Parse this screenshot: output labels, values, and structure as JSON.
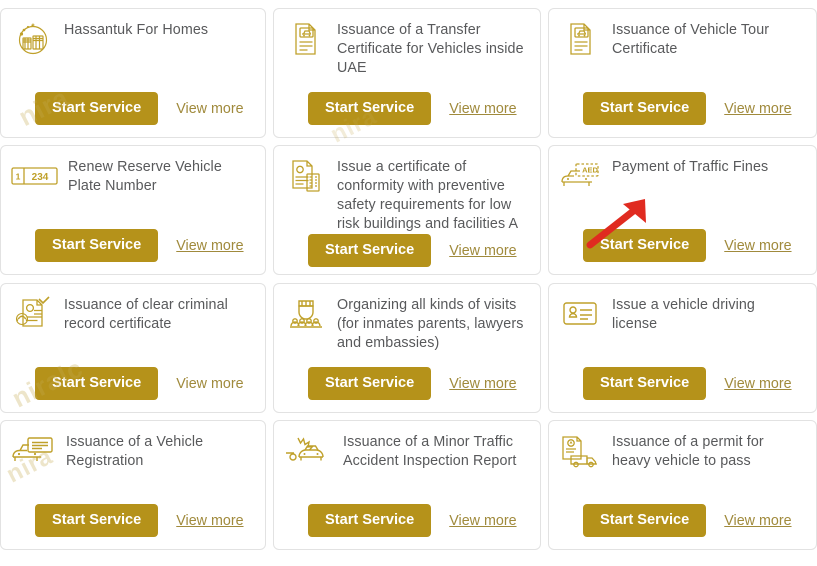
{
  "page": {
    "accent_color": "#b5921a",
    "icon_color": "#bfa02a",
    "title_color": "#58595b",
    "link_color": "#a08a3c",
    "card_border_color": "#e2e2e2",
    "annotation_color": "#e02b20"
  },
  "labels": {
    "start_service": "Start Service",
    "view_more": "View more"
  },
  "watermarks": [
    {
      "text": "nira"
    },
    {
      "text": "niralc"
    },
    {
      "text": "nira"
    },
    {
      "text": "nira"
    }
  ],
  "annotation": {
    "type": "arrow",
    "points_to": "Start Service button of Payment of Traffic Fines card",
    "color": "#e02b20"
  },
  "cards": [
    {
      "id": "hassantuk-for-homes",
      "title": "Hassantuk For Homes",
      "icon": "hassantuk-logo-icon",
      "start_service": "Start Service",
      "view_more": "View more",
      "view_more_underlined": false
    },
    {
      "id": "transfer-certificate-vehicles-uae",
      "title": "Issuance of a Transfer Certificate for Vehicles inside UAE",
      "icon": "vehicle-document-icon",
      "start_service": "Start Service",
      "view_more": "View more",
      "view_more_underlined": true
    },
    {
      "id": "vehicle-tour-certificate",
      "title": "Issuance of Vehicle Tour Certificate",
      "icon": "vehicle-document-icon",
      "start_service": "Start Service",
      "view_more": "View more",
      "view_more_underlined": true
    },
    {
      "id": "renew-reserve-vehicle-plate-number",
      "title": "Renew Reserve Vehicle Plate Number",
      "icon": "license-plate-icon",
      "icon_text_left": "1",
      "icon_text_right": "234",
      "start_service": "Start Service",
      "view_more": "View more",
      "view_more_underlined": true
    },
    {
      "id": "certificate-conformity-preventive-safety",
      "title": "Issue a certificate of conformity with preventive safety requirements for low risk buildings and facilities A",
      "icon": "certificate-buildings-icon",
      "start_service": "Start Service",
      "view_more": "View more",
      "view_more_underlined": true
    },
    {
      "id": "payment-of-traffic-fines",
      "title": "Payment of Traffic Fines",
      "icon": "traffic-fine-aed-icon",
      "icon_text": "AED",
      "start_service": "Start Service",
      "view_more": "View more",
      "view_more_underlined": true,
      "annotated": true
    },
    {
      "id": "clear-criminal-record-certificate",
      "title": "Issuance of clear criminal record certificate",
      "icon": "criminal-record-fingerprint-icon",
      "start_service": "Start Service",
      "view_more": "View more",
      "view_more_underlined": false
    },
    {
      "id": "organizing-visits",
      "title": "Organizing all kinds of visits (for inmates parents, lawyers and embassies)",
      "icon": "visitors-group-icon",
      "start_service": "Start Service",
      "view_more": "View more",
      "view_more_underlined": true
    },
    {
      "id": "vehicle-driving-license",
      "title": "Issue a vehicle driving license",
      "icon": "driving-license-card-icon",
      "start_service": "Start Service",
      "view_more": "View more",
      "view_more_underlined": true
    },
    {
      "id": "vehicle-registration",
      "title": "Issuance of a Vehicle Registration",
      "icon": "vehicle-registration-icon",
      "start_service": "Start Service",
      "view_more": "View more",
      "view_more_underlined": true
    },
    {
      "id": "minor-traffic-accident-report",
      "title": "Issuance of a Minor Traffic Accident Inspection Report",
      "icon": "car-accident-icon",
      "start_service": "Start Service",
      "view_more": "View more",
      "view_more_underlined": true
    },
    {
      "id": "permit-heavy-vehicle-pass",
      "title": "Issuance of a permit for heavy vehicle to pass",
      "icon": "heavy-vehicle-permit-icon",
      "start_service": "Start Service",
      "view_more": "View more",
      "view_more_underlined": true
    }
  ]
}
